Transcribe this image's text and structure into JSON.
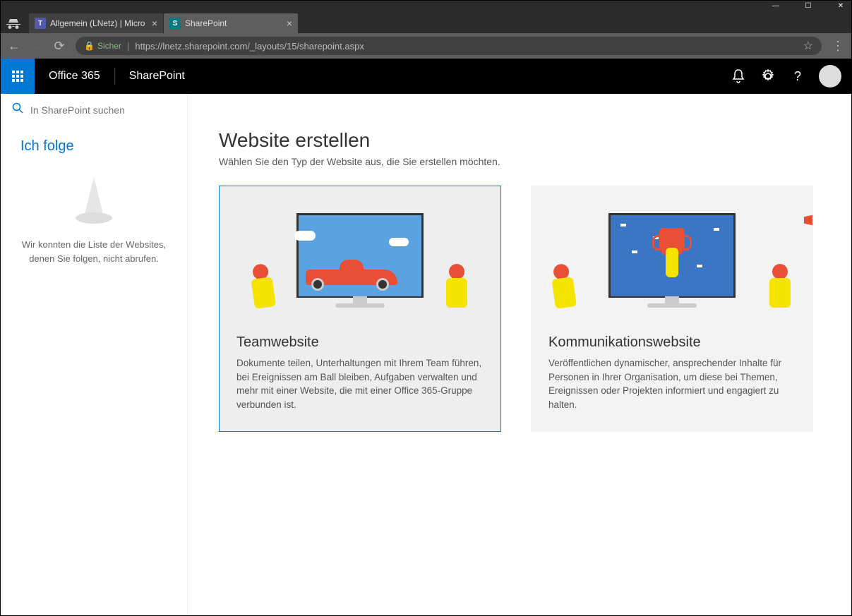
{
  "titlebar": {
    "minimize": "—",
    "maximize": "☐",
    "close": "✕"
  },
  "tabs": [
    {
      "label": "Allgemein (LNetz) | Micro",
      "icon": "teams"
    },
    {
      "label": "SharePoint",
      "icon": "sp"
    }
  ],
  "addressbar": {
    "secure_label": "Sicher",
    "url": "https://lnetz.sharepoint.com/_layouts/15/sharepoint.aspx"
  },
  "suite": {
    "brand": "Office 365",
    "app": "SharePoint"
  },
  "sidebar": {
    "search_placeholder": "In SharePoint suchen",
    "follow_heading": "Ich folge",
    "follow_empty": "Wir konnten die Liste der Websites, denen Sie folgen, nicht abrufen."
  },
  "main": {
    "title": "Website erstellen",
    "subtitle": "Wählen Sie den Typ der Website aus, die Sie erstellen möchten.",
    "cards": [
      {
        "title": "Teamwebsite",
        "desc": "Dokumente teilen, Unterhaltungen mit Ihrem Team führen, bei Ereignissen am Ball bleiben, Aufgaben verwalten und mehr mit einer Website, die mit einer Office 365-Gruppe verbunden ist."
      },
      {
        "title": "Kommunikationswebsite",
        "desc": "Veröffentlichen dynamischer, ansprechender Inhalte für Personen in Ihrer Organisation, um diese bei Themen, Ereignissen oder Projekten informiert und engagiert zu halten."
      }
    ]
  }
}
